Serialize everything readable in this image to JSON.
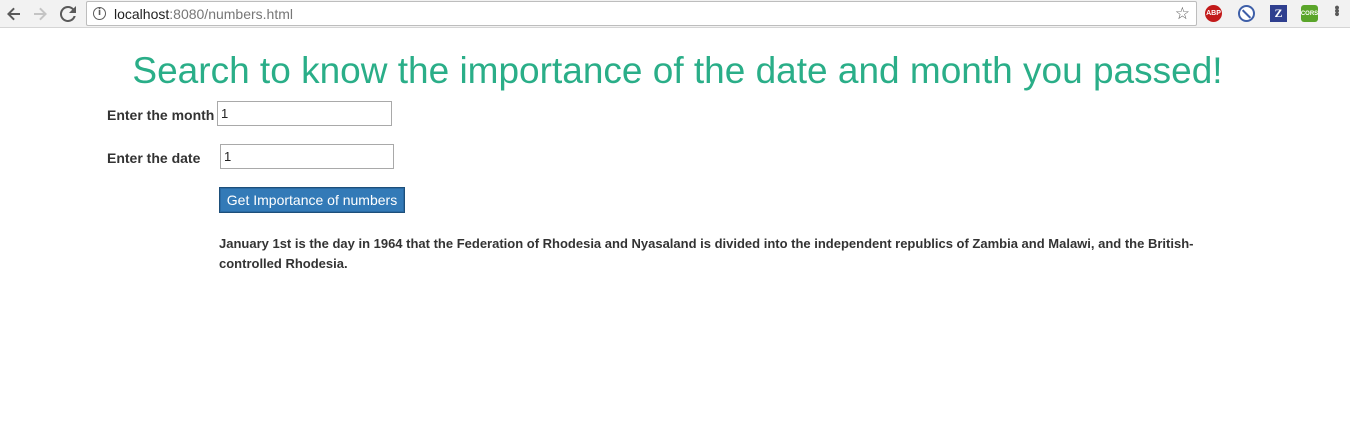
{
  "browser": {
    "url_host": "localhost",
    "url_rest": ":8080/numbers.html",
    "extensions": [
      {
        "name": "adblock-plus",
        "label": "ABP",
        "color": "#c21a1a"
      },
      {
        "name": "block",
        "label": "",
        "color": "#3e5fa8"
      },
      {
        "name": "zotero",
        "label": "Z",
        "color": "#2f3f8f"
      },
      {
        "name": "cors",
        "label": "CORS",
        "color": "#5aa52a"
      }
    ]
  },
  "page": {
    "title": "Search to know the importance of the date and month you passed!",
    "title_color": "#2aae88",
    "month_label": "Enter the month",
    "month_value": "1",
    "date_label": "Enter the date",
    "date_value": "1",
    "button_label": "Get Importance of numbers",
    "button_color": "#337ab7",
    "result": "January 1st is the day in 1964 that the Federation of Rhodesia and Nyasaland is divided into the independent republics of Zambia and Malawi, and the British-controlled Rhodesia."
  }
}
